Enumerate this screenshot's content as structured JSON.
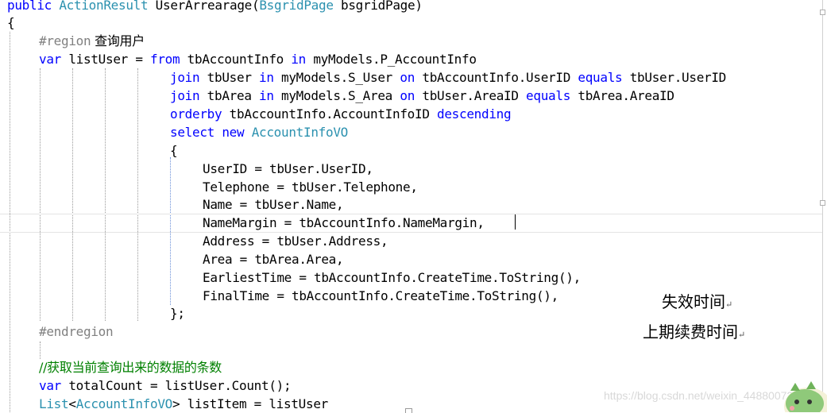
{
  "code": {
    "l00": {
      "k1": "public",
      "t1": "ActionResult",
      "t2": " UserArrearage(",
      "t3": "BsgridPage",
      "t4": " bsgridPage)"
    },
    "l01": {
      "t": "{"
    },
    "l02": {
      "k": "#region",
      "t": " 查询用户"
    },
    "l03": {
      "k1": "var",
      "t1": " listUser = ",
      "k2": "from",
      "t2": " tbAccountInfo ",
      "k3": "in",
      "t3": " myModels.P_AccountInfo"
    },
    "l04": {
      "k1": "join",
      "t1": " tbUser ",
      "k2": "in",
      "t2": " myModels.S_User ",
      "k3": "on",
      "t3": " tbAccountInfo.UserID ",
      "k4": "equals",
      "t4": " tbUser.UserID"
    },
    "l05": {
      "k1": "join",
      "t1": " tbArea ",
      "k2": "in",
      "t2": " myModels.S_Area ",
      "k3": "on",
      "t3": " tbUser.AreaID ",
      "k4": "equals",
      "t4": " tbArea.AreaID"
    },
    "l06": {
      "k1": "orderby",
      "t1": " tbAccountInfo.AccountInfoID ",
      "k2": "descending"
    },
    "l07": {
      "k1": "select",
      "t1": " ",
      "k2": "new",
      "t2": " ",
      "ty": "AccountInfoVO"
    },
    "l08": {
      "t": "{"
    },
    "l09": {
      "t": "UserID = tbUser.UserID,"
    },
    "l10": {
      "t": "Telephone = tbUser.Telephone,"
    },
    "l11": {
      "t": "Name = tbUser.Name,"
    },
    "l12": {
      "t": "NameMargin = tbAccountInfo.NameMargin,"
    },
    "l13": {
      "t": "Address = tbUser.Address,"
    },
    "l14": {
      "t": "Area = tbArea.Area,"
    },
    "l15": {
      "t": "EarliestTime = tbAccountInfo.CreateTime.ToString(),"
    },
    "l16": {
      "t": "FinalTime = tbAccountInfo.CreateTime.ToString(),"
    },
    "l17": {
      "t": "};"
    },
    "l18": {
      "k": "#endregion"
    },
    "l20": {
      "c": "//获取当前查询出来的数据的条数"
    },
    "l21": {
      "k": "var",
      "t": " totalCount = listUser.Count();"
    },
    "l22": {
      "ty1": "List",
      "t1": "<",
      "ty2": "AccountInfoVO",
      "t2": "> listItem = listUser"
    }
  },
  "annotations": {
    "a1": "失效时间",
    "a2": "上期续费时间",
    "return_mark": "↵"
  },
  "watermark": "https://blog.csdn.net/weixin_44880072",
  "colors": {
    "keyword": "#0000ff",
    "type": "#2b91af",
    "comment": "#008000",
    "region": "#808080",
    "text": "#000000"
  }
}
